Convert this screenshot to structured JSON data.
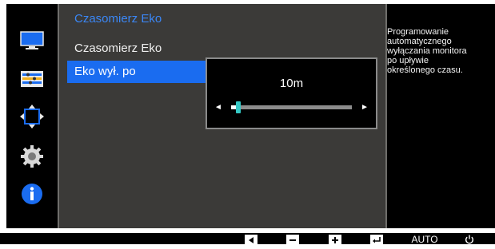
{
  "menu": {
    "title": "Czasomierz Eko",
    "items": [
      {
        "label": "Czasomierz Eko",
        "selected": false
      },
      {
        "label": "Eko wył. po",
        "selected": true
      }
    ]
  },
  "popup": {
    "value_text": "10m",
    "slider_fraction": 0.06
  },
  "help": {
    "text": "Programowanie\nautomatycznego\nwyłączania monitora\npo upływie\nokreślonego czasu."
  },
  "sidebar": {
    "icons": [
      "monitor-icon",
      "picture-settings-icon",
      "position-size-icon",
      "settings-gear-icon",
      "info-icon"
    ],
    "active_color": "#1a6cf0"
  },
  "bottom_bar": {
    "buttons": [
      {
        "name": "left-arrow-button"
      },
      {
        "name": "minus-button"
      },
      {
        "name": "plus-button"
      },
      {
        "name": "enter-button"
      },
      {
        "name": "auto-button",
        "label": "AUTO"
      },
      {
        "name": "power-button"
      }
    ]
  },
  "colors": {
    "accent": "#1a6cf0",
    "title": "#3b87f6",
    "knob": "#35c9c6"
  }
}
